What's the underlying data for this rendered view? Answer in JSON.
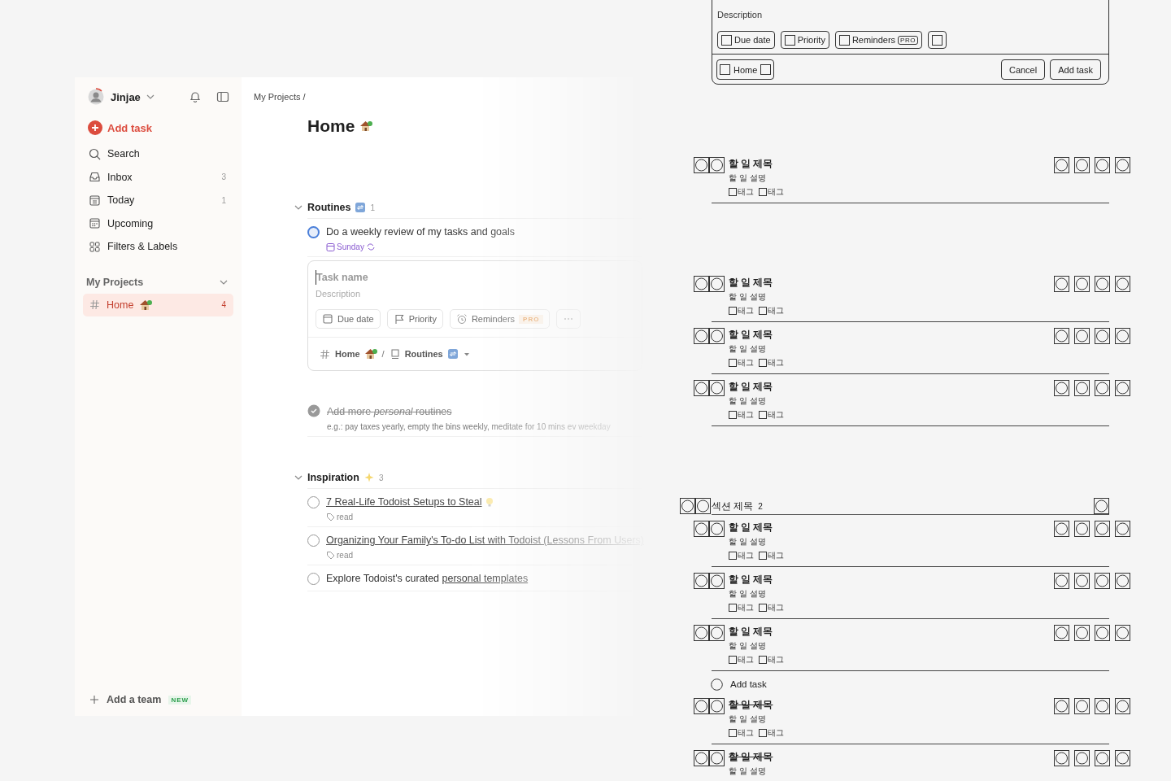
{
  "app": {
    "sidebar": {
      "user": "Jinjae",
      "add_task": "Add task",
      "nav": [
        {
          "label": "Search"
        },
        {
          "label": "Inbox",
          "count": "3"
        },
        {
          "label": "Today",
          "count": "1"
        },
        {
          "label": "Upcoming"
        },
        {
          "label": "Filters & Labels"
        }
      ],
      "projects_header": "My Projects",
      "projects": [
        {
          "name": "Home",
          "count": "4",
          "selected": true
        }
      ],
      "add_team": "Add a team",
      "add_team_badge": "NEW"
    },
    "main": {
      "breadcrumb": "My Projects /",
      "title": "Home",
      "sections": [
        {
          "name": "Routines",
          "count": "1",
          "expanded": true,
          "items": [
            {
              "kind": "task",
              "title": "Do a weekly review of my tasks and goals",
              "checked": false,
              "color": "#4a7fd9",
              "due": "Sunday",
              "recurring": true
            },
            {
              "kind": "editor",
              "name": {
                "placeholder": "Task name"
              },
              "description": {
                "placeholder": "Description"
              },
              "chips": [
                {
                  "kind": "due",
                  "label": "Due date"
                },
                {
                  "kind": "priority",
                  "label": "Priority"
                },
                {
                  "kind": "reminders",
                  "label": "Reminders",
                  "badge": "PRO"
                },
                {
                  "kind": "more"
                }
              ],
              "project": "Home",
              "separator": "/",
              "section": "Routines"
            },
            {
              "kind": "task",
              "title": "Add more *personal* routines",
              "checked": true,
              "description": "e.g.: pay taxes yearly, empty the bins weekly, meditate for 10 mins ev weekday"
            }
          ]
        },
        {
          "name": "Inspiration",
          "count": "3",
          "expanded": true,
          "items": [
            {
              "kind": "task",
              "link": "7 Real-Life Todoist Setups to Steal",
              "checked": false,
              "label": "read"
            },
            {
              "kind": "task",
              "link": "Organizing Your Family's To-do List with Todoist (Lessons From Users)",
              "checked": false,
              "label": "read"
            },
            {
              "kind": "task",
              "text": "Explore Todoist's curated ",
              "link": "personal templates",
              "checked": false
            }
          ]
        }
      ]
    }
  },
  "wireframe": {
    "form": {
      "description": {
        "placeholder": "Description"
      },
      "chips": [
        {
          "kind": "text",
          "label": "Due date"
        },
        {
          "kind": "text",
          "label": "Priority"
        },
        {
          "kind": "text",
          "label": "Reminders",
          "badge": "PRO"
        },
        {
          "kind": "icon"
        }
      ],
      "project": "Home",
      "buttons": [
        "Cancel",
        "Add task"
      ]
    },
    "groups": [
      {
        "tasks": [
          {
            "title": "할 일 제목",
            "description": "할 일 설명",
            "tags": [
              "태그",
              "태그"
            ],
            "completed": false
          }
        ]
      },
      {
        "tasks": [
          {
            "title": "할 일 제목",
            "description": "할 일 설명",
            "tags": [
              "태그",
              "태그"
            ],
            "completed": false
          },
          {
            "title": "할 일 제목",
            "description": "할 일 설명",
            "tags": [
              "태그",
              "태그"
            ],
            "completed": false
          },
          {
            "title": "할 일 제목",
            "description": "할 일 설명",
            "tags": [
              "태그",
              "태그"
            ],
            "completed": false
          }
        ]
      },
      {
        "section": {
          "title": "섹션 제목",
          "count": "2"
        },
        "tasks": [
          {
            "title": "할 일 제목",
            "description": "할 일 설명",
            "tags": [
              "태그",
              "태그"
            ],
            "completed": false
          },
          {
            "title": "할 일 제목",
            "description": "할 일 설명",
            "tags": [
              "태그",
              "태그"
            ],
            "completed": false
          },
          {
            "title": "할 일 제목",
            "description": "할 일 설명",
            "tags": [
              "태그",
              "태그"
            ],
            "completed": false
          }
        ],
        "add_task": "Add task",
        "completed": [
          {
            "title": "할 일 제목",
            "description": "할 일 설명",
            "tags": [
              "태그",
              "태그"
            ],
            "completed": true
          },
          {
            "title": "할 일 제목",
            "description": "할 일 설명",
            "completed": true
          }
        ]
      }
    ]
  }
}
